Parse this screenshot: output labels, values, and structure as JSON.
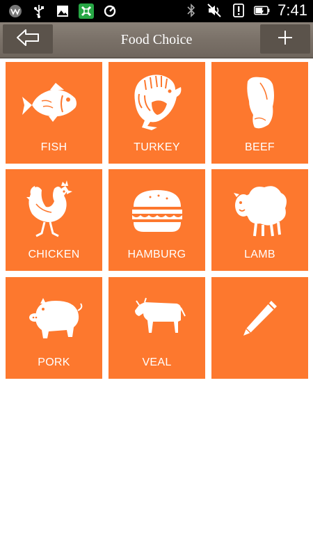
{
  "status_bar": {
    "time": "7:41",
    "left_icons": [
      "app-icon",
      "usb-icon",
      "image-icon",
      "app-grid-icon",
      "sync-icon"
    ],
    "right_icons": [
      "bluetooth-icon",
      "mute-icon",
      "alert-icon",
      "battery-icon"
    ]
  },
  "header": {
    "title": "Food Choice",
    "back_icon": "back-arrow-icon",
    "add_icon": "plus-icon"
  },
  "colors": {
    "tile": "#fd782e",
    "actionbar": "#7a7168",
    "button": "#5b534b"
  },
  "tiles": [
    {
      "label": "FISH",
      "icon": "fish-icon"
    },
    {
      "label": "TURKEY",
      "icon": "turkey-icon"
    },
    {
      "label": "BEEF",
      "icon": "beef-icon"
    },
    {
      "label": "CHICKEN",
      "icon": "rooster-icon"
    },
    {
      "label": "HAMBURG",
      "icon": "hamburger-icon"
    },
    {
      "label": "LAMB",
      "icon": "sheep-icon"
    },
    {
      "label": "PORK",
      "icon": "pig-icon"
    },
    {
      "label": "VEAL",
      "icon": "cow-icon"
    },
    {
      "label": "",
      "icon": "pencil-icon"
    }
  ]
}
